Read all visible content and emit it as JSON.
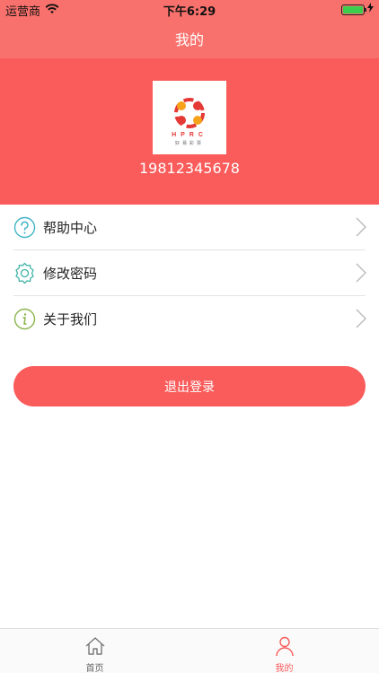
{
  "status_bar": {
    "carrier": "运营商",
    "time": "下午6:29",
    "battery_level": 1.0
  },
  "nav": {
    "title": "我的"
  },
  "profile": {
    "avatar_letters": "HPRC",
    "avatar_sub": "好易彩票",
    "phone": "19812345678"
  },
  "menu": {
    "items": [
      {
        "label": "帮助中心",
        "icon": "help-icon"
      },
      {
        "label": "修改密码",
        "icon": "settings-gear-icon"
      },
      {
        "label": "关于我们",
        "icon": "info-icon"
      }
    ]
  },
  "logout": {
    "label": "退出登录"
  },
  "tabbar": {
    "items": [
      {
        "label": "首页",
        "icon": "home-icon",
        "active": false
      },
      {
        "label": "我的",
        "icon": "user-icon",
        "active": true
      }
    ]
  },
  "colors": {
    "header": "#f9716c",
    "accent": "#f95c5b",
    "active_tab": "#f95c5b",
    "inactive_tab": "#666666"
  }
}
